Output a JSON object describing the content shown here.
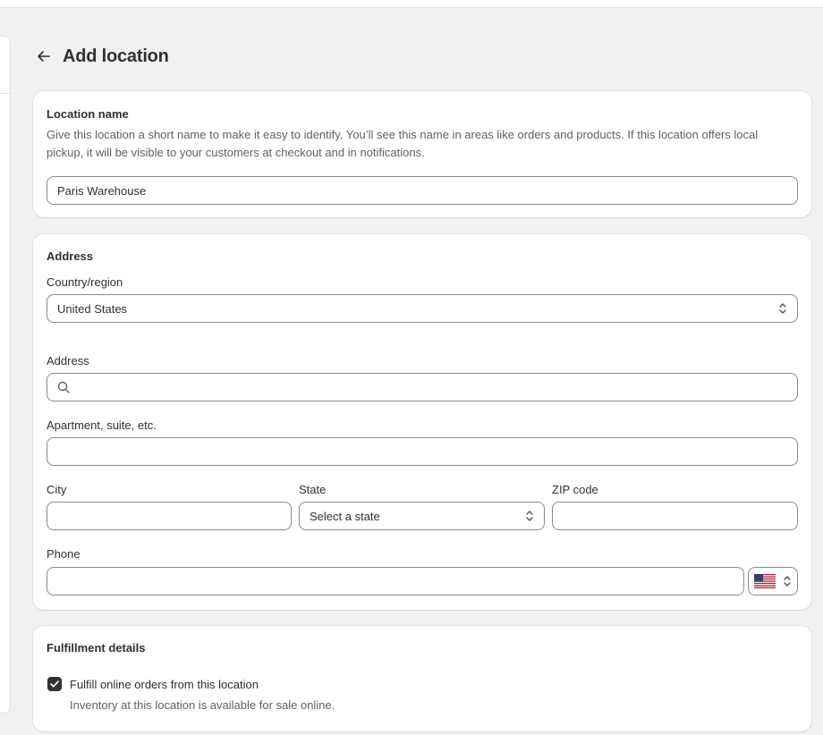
{
  "page": {
    "title": "Add location",
    "back_icon": "arrow-left-icon"
  },
  "location_card": {
    "title": "Location name",
    "help": "Give this location a short name to make it easy to identify. You’ll see this name in areas like orders and products. If this location offers local pickup, it will be visible to your customers at checkout and in notifications.",
    "name_value": "Paris Warehouse"
  },
  "address_card": {
    "title": "Address",
    "country_label": "Country/region",
    "country_value": "United States",
    "address_label": "Address",
    "address_value": "",
    "apartment_label": "Apartment, suite, etc.",
    "apartment_value": "",
    "city_label": "City",
    "city_value": "",
    "state_label": "State",
    "state_value": "Select a state",
    "zip_label": "ZIP code",
    "zip_value": "",
    "phone_label": "Phone",
    "phone_value": "",
    "phone_country_icon": "us-flag-icon"
  },
  "fulfillment_card": {
    "title": "Fulfillment details",
    "checkbox_label": "Fulfill online orders from this location",
    "checkbox_checked": true,
    "checkbox_help": "Inventory at this location is available for sale online."
  },
  "colors": {
    "background": "#f1f1f1",
    "card": "#ffffff",
    "border": "#8a8a8a",
    "text": "#303030",
    "muted": "#616161"
  }
}
